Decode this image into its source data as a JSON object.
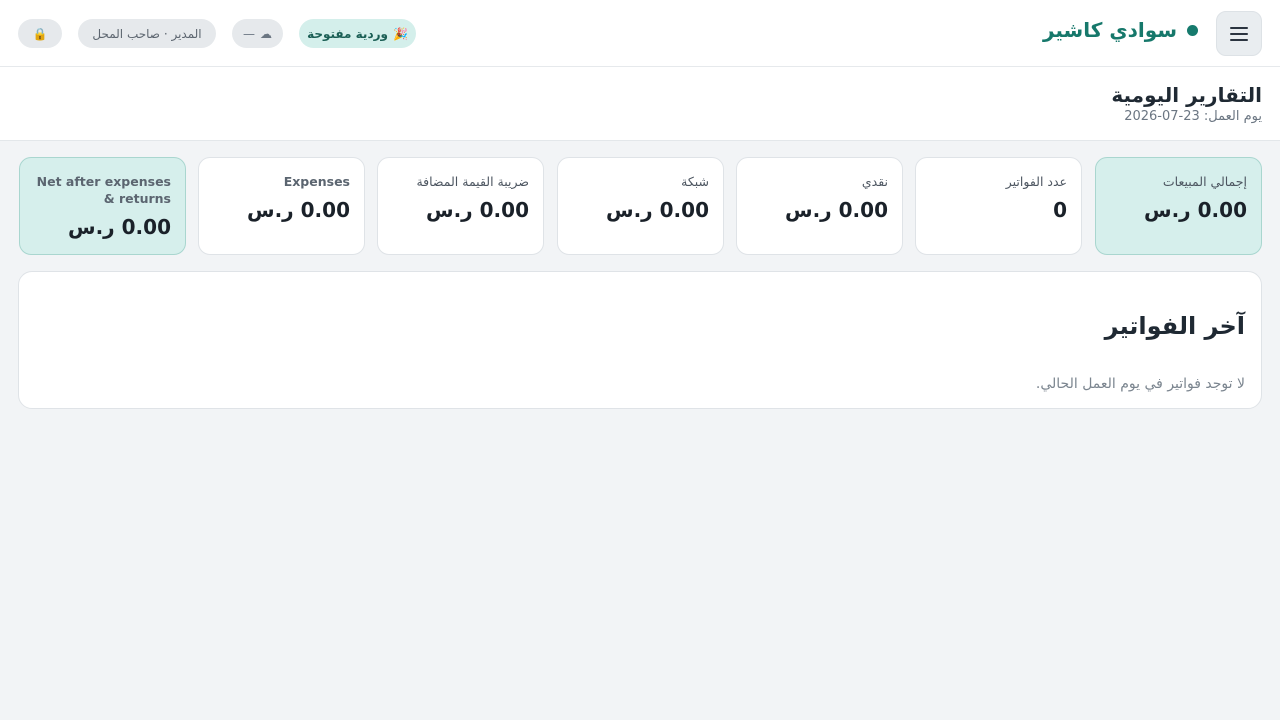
{
  "topbar": {
    "menu_icon": "hamburger-menu-icon",
    "brand_title": "سوادي كاشير",
    "shift_badge": {
      "icon": "🎉",
      "label": "وردية مفتوحة"
    },
    "sync_status": {
      "icon": "☁",
      "label": "—"
    },
    "user_badge": "المدير · صاحب المحل",
    "lock_icon": "🔒"
  },
  "header": {
    "title": "التقارير اليومية",
    "business_day_label": "يوم العمل:",
    "business_day_value": "2026-07-23"
  },
  "stats": [
    {
      "label": "إجمالي المبيعات",
      "value": "0.00 ر.س"
    },
    {
      "label": "عدد الفواتير",
      "value": "0"
    },
    {
      "label": "نقدي",
      "value": "0.00 ر.س"
    },
    {
      "label": "شبكة",
      "value": "0.00 ر.س"
    },
    {
      "label": "ضريبة القيمة المضافة",
      "value": "0.00 ر.س"
    },
    {
      "label": "Expenses",
      "value": "0.00 ر.س"
    },
    {
      "label": "Net after expenses & returns",
      "value": "0.00 ر.س"
    }
  ],
  "invoices": {
    "title": "آخر الفواتير",
    "empty_text": "لا توجد فواتير في يوم العمل الحالي."
  },
  "colors": {
    "brand": "#16786b",
    "accent_card": "#d6efec",
    "background": "#f2f4f6"
  }
}
